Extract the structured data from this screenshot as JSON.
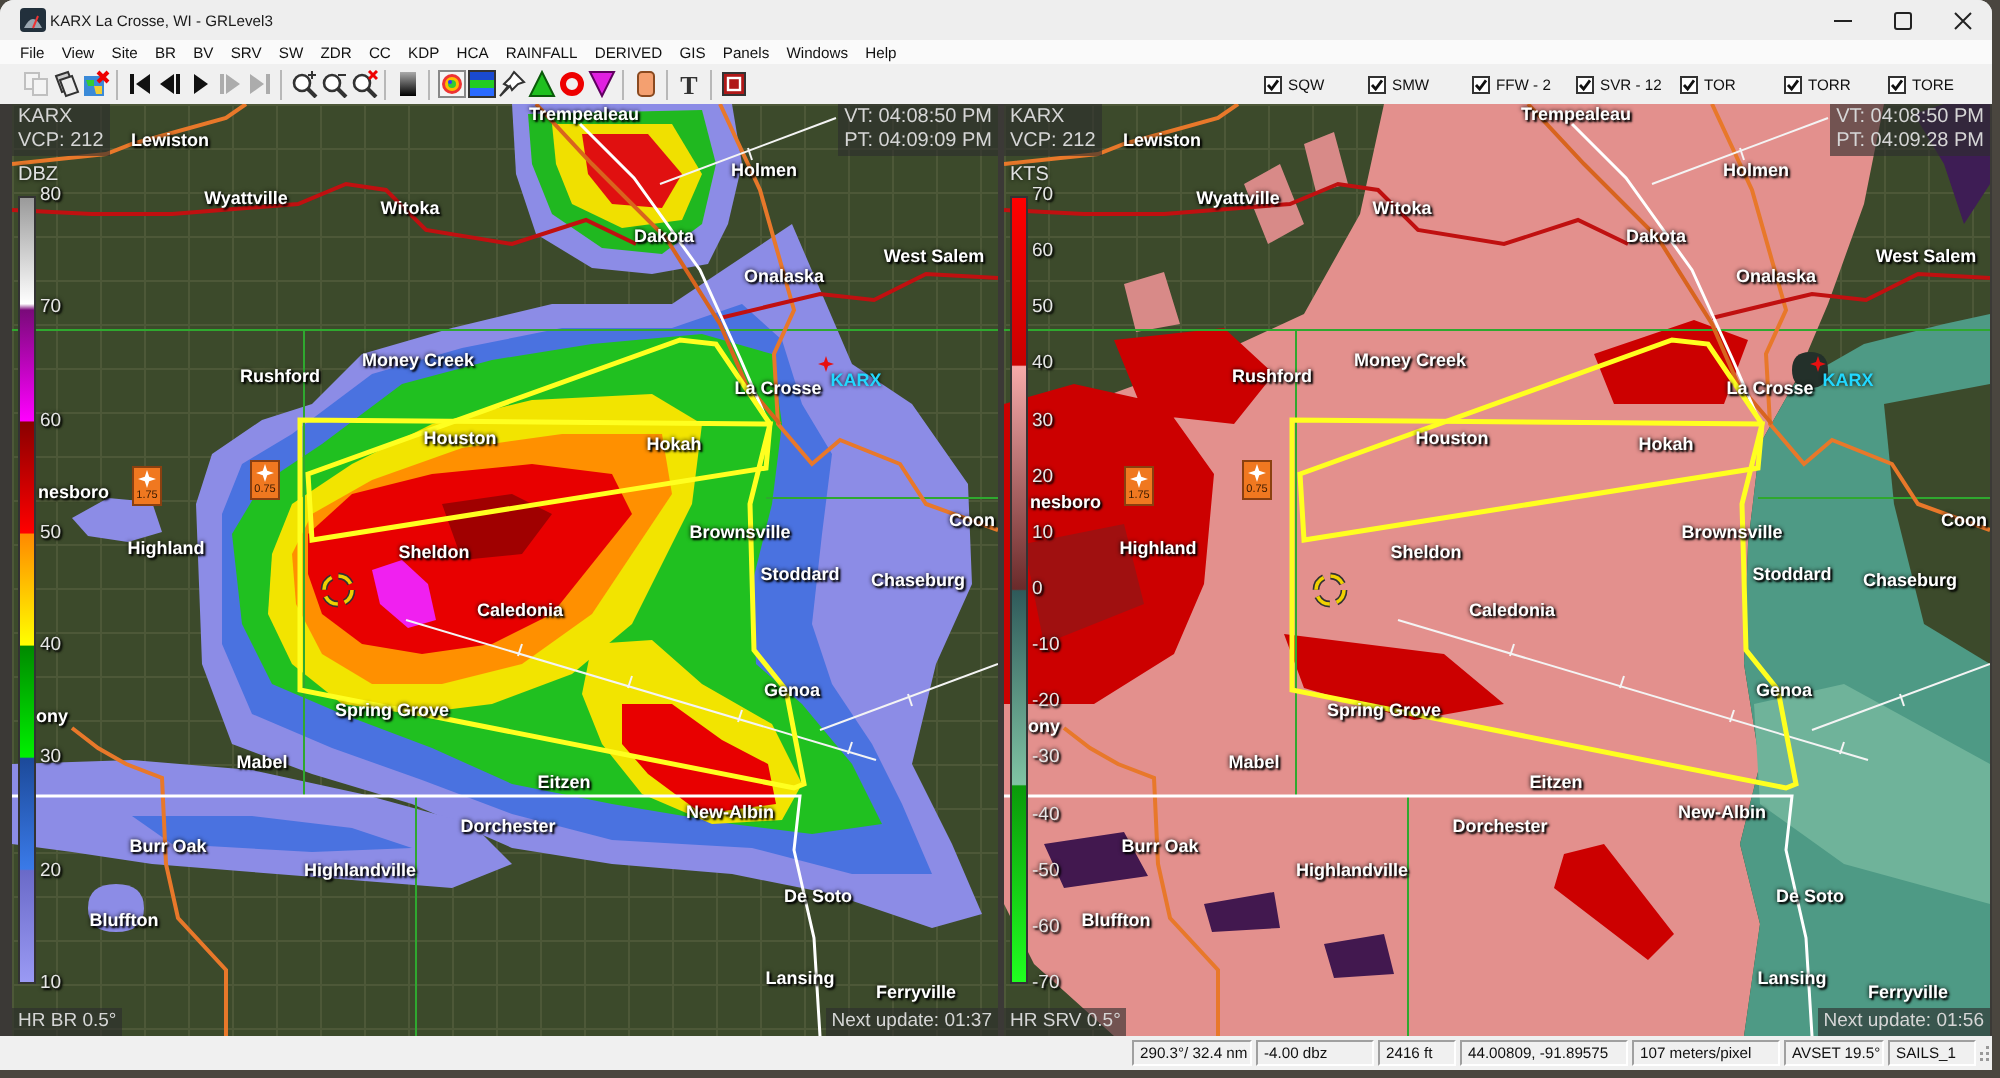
{
  "window": {
    "title": "KARX La Crosse, WI - GRLevel3"
  },
  "menu": [
    "File",
    "View",
    "Site",
    "BR",
    "BV",
    "SRV",
    "SW",
    "ZDR",
    "CC",
    "KDP",
    "HCA",
    "RAINFALL",
    "DERIVED",
    "GIS",
    "Panels",
    "Windows",
    "Help"
  ],
  "toolbar": [
    [
      {
        "disabled": true
      },
      {
        "disabled": false
      },
      {
        "disabled": false
      }
    ],
    [
      {
        "disabled": false
      },
      {
        "disabled": false
      },
      {
        "disabled": false
      },
      {
        "disabled": true
      },
      {
        "disabled": true
      }
    ],
    [
      {
        "disabled": false
      },
      {
        "disabled": false
      },
      {
        "disabled": false
      }
    ],
    [
      {
        "disabled": false
      }
    ],
    [
      {
        "disabled": false
      },
      {
        "disabled": false
      },
      {
        "disabled": false
      },
      {
        "disabled": false
      },
      {
        "disabled": false
      },
      {
        "disabled": false
      }
    ],
    [
      {
        "disabled": false
      }
    ],
    [
      {
        "label": "T",
        "disabled": false
      }
    ],
    [
      {
        "disabled": false
      }
    ]
  ],
  "warning_filters": [
    {
      "label": "SQW",
      "checked": true
    },
    {
      "label": "SMW",
      "checked": true
    },
    {
      "label": "FFW - 2",
      "checked": true
    },
    {
      "label": "SVR - 12",
      "checked": true
    },
    {
      "label": "TOR",
      "checked": true
    },
    {
      "label": "TORR",
      "checked": true
    },
    {
      "label": "TORE",
      "checked": true
    }
  ],
  "panels": [
    {
      "kind": "reflectivity",
      "site": "KARX",
      "vcp": "VCP: 212",
      "valid_time": "VT: 04:08:50 PM",
      "product_time": "PT: 04:09:09 PM",
      "unit": "DBZ",
      "scale": [
        "80",
        "70",
        "60",
        "50",
        "40",
        "30",
        "20",
        "10"
      ],
      "cities": [
        "Trempealeau",
        "Lewiston",
        "Holmen",
        "Wyattville",
        "Witoka",
        "Dakota",
        "West Salem",
        "Onalaska",
        "Money Creek",
        "Rushford",
        "La Crosse",
        "Houston",
        "Hokah",
        "nesboro",
        "Coon",
        "Brownsville",
        "Highland",
        "Sheldon",
        "Stoddard",
        "Chaseburg",
        "Caledonia",
        "Genoa",
        "Spring Grove",
        "ony",
        "Mabel",
        "Eitzen",
        "New-Albin",
        "Dorchester",
        "Burr Oak",
        "Highlandville",
        "De Soto",
        "Bluffton",
        "Lansing",
        "Ferryville"
      ],
      "radar_site": "KARX",
      "hail_markers": [
        {
          "size": "1.75"
        },
        {
          "size": "0.75"
        }
      ],
      "product": "HR BR 0.5°",
      "next_update": "Next update: 01:37"
    },
    {
      "kind": "velocity",
      "site": "KARX",
      "vcp": "VCP: 212",
      "valid_time": "VT: 04:08:50 PM",
      "product_time": "PT: 04:09:28 PM",
      "unit": "KTS",
      "scale": [
        "70",
        "60",
        "50",
        "40",
        "30",
        "20",
        "10",
        "0",
        "-10",
        "-20",
        "-30",
        "-40",
        "-50",
        "-60",
        "-70"
      ],
      "cities": [
        "Trempealeau",
        "Lewiston",
        "Holmen",
        "Wyattville",
        "Witoka",
        "Dakota",
        "West Salem",
        "Onalaska",
        "Money Creek",
        "Rushford",
        "La Crosse",
        "Houston",
        "Hokah",
        "nesboro",
        "Coon",
        "Brownsville",
        "Highland",
        "Sheldon",
        "Stoddard",
        "Chaseburg",
        "Caledonia",
        "Genoa",
        "Spring Grove",
        "ony",
        "Mabel",
        "Eitzen",
        "New-Albin",
        "Dorchester",
        "Burr Oak",
        "Highlandville",
        "De Soto",
        "Bluffton",
        "Lansing",
        "Ferryville"
      ],
      "radar_site": "KARX",
      "hail_markers": [
        {
          "size": "1.75"
        },
        {
          "size": "0.75"
        }
      ],
      "product": "HR SRV 0.5°",
      "next_update": "Next update: 01:56"
    }
  ],
  "status_bar": [
    "290.3°/ 32.4 nm",
    "-4.00 dbz",
    "2416 ft",
    "44.00809, -91.89575",
    "107 meters/pixel",
    "AVSET 19.5°",
    "SAILS_1"
  ]
}
